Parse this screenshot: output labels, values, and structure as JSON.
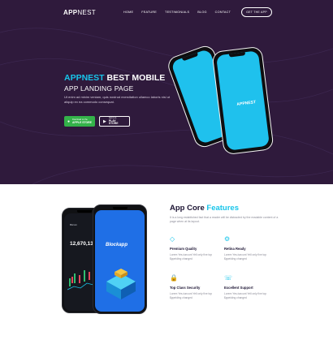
{
  "header": {
    "logo_bold": "APP",
    "logo_light": "NEST",
    "nav": [
      "HOME",
      "FEATURE",
      "TESTIMONIALS",
      "BLOG",
      "CONTACT"
    ],
    "cta": "GET THE APP"
  },
  "hero": {
    "headline_accent": "APPNEST",
    "headline_rest": " BEST MOBILE",
    "subhead": "APP LANDING PAGE",
    "description": "Ut enim ad minim veniam, quis nostrud exercitation ullamco laboris nisi ut aliquip ex ea commodo consequat.",
    "apple_small": "Download on the",
    "apple_big": "APPLE STORE",
    "play_small": "Get it on",
    "play_big": "PLAY STORE",
    "phone_logo": "APPNEST"
  },
  "features": {
    "title_plain": "App Core ",
    "title_accent": "Features",
    "description": "It is a long established fact that a reader will be distracted by the readable content of a page when at its layout.",
    "items": [
      {
        "icon": "diamond-icon",
        "glyph": "◇",
        "title": "Premium Quality",
        "text": "Lorem Yes-tuncunt Yell only five top $ppeiding changed"
      },
      {
        "icon": "gear-icon",
        "glyph": "⚙",
        "title": "Retina Ready",
        "text": "Lorem Yes-tuncunt Yell only five top $ppeiding changed"
      },
      {
        "icon": "lock-icon",
        "glyph": "🔒",
        "title": "Top Class Security",
        "text": "Lorem Yes-tuncunt Yell only five top $ppeiding changed"
      },
      {
        "icon": "support-icon",
        "glyph": "☏",
        "title": "Excellent Support",
        "text": "Lorem Yes-tuncunt Yell only five top $ppeiding changed"
      }
    ]
  },
  "showcase": {
    "back_title": "Bitcoin",
    "back_price": "12,670,13",
    "front_logo": "Blockapp"
  },
  "colors": {
    "hero_bg": "#2f1a3c",
    "accent": "#18c5ea",
    "store_green": "#34b24a",
    "phone_screen": "#1fc1ed",
    "block_blue": "#1f6fe6"
  }
}
